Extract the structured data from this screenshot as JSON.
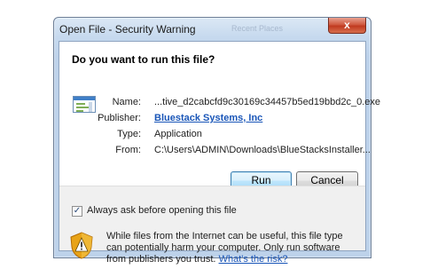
{
  "window": {
    "title": "Open File - Security Warning",
    "background_ghost_text": "Recent Places",
    "close_glyph": "x"
  },
  "dialog": {
    "question": "Do you want to run this file?",
    "file_icon": "application-file-icon",
    "fields": [
      {
        "label": "Name:",
        "value": "...tive_d2cabcfd9c30169c34457b5ed19bbd2c_0.exe",
        "is_link": false
      },
      {
        "label": "Publisher:",
        "value": "Bluestack Systems, Inc",
        "is_link": true
      },
      {
        "label": "Type:",
        "value": "Application",
        "is_link": false
      },
      {
        "label": "From:",
        "value": "C:\\Users\\ADMIN\\Downloads\\BlueStacksInstaller...",
        "is_link": false
      }
    ],
    "buttons": {
      "run": "Run",
      "cancel": "Cancel"
    },
    "checkbox": {
      "label": "Always ask before opening this file",
      "checked": true
    },
    "warning": {
      "icon": "security-shield-warning-icon",
      "text": "While files from the Internet can be useful, this file type can potentially harm your computer. Only run software from publishers you trust.",
      "link": "What's the risk?"
    }
  },
  "colors": {
    "link": "#1a56b8",
    "shield_gold": "#e8a317",
    "shield_dark": "#b36b00",
    "close_red": "#c8442a"
  }
}
